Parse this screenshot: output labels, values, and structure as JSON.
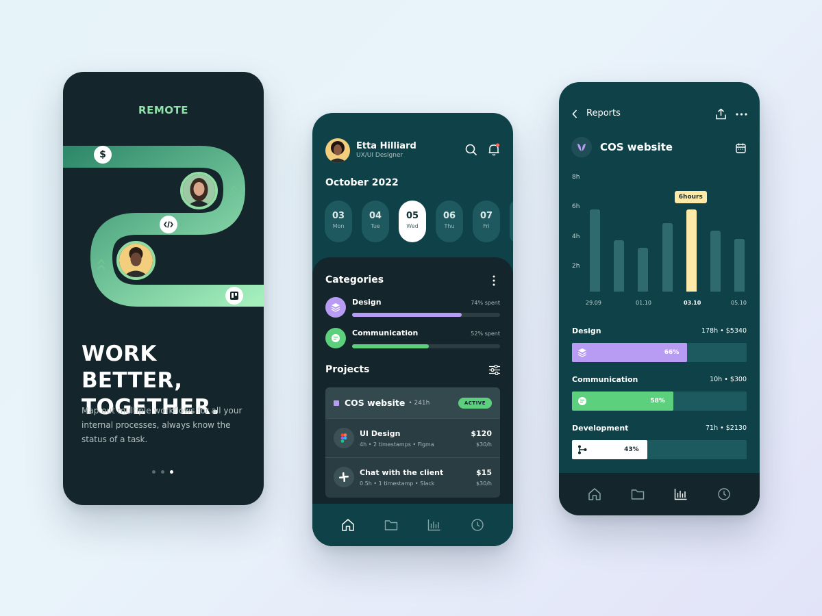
{
  "phone1": {
    "brand": "REMOTE",
    "headline": "WORK BETTER,\nTOGETHER.",
    "description": "Map out multiple workflows for all your internal processes, always know the status of a task.",
    "badge_dollar": "$",
    "pager": {
      "count": 3,
      "active": 2
    }
  },
  "phone2": {
    "user": {
      "name": "Etta Hilliard",
      "role": "UX/UI Designer"
    },
    "month": "October 2022",
    "days": [
      {
        "num": "03",
        "wd": "Mon"
      },
      {
        "num": "04",
        "wd": "Tue"
      },
      {
        "num": "05",
        "wd": "Wed"
      },
      {
        "num": "06",
        "wd": "Thu"
      },
      {
        "num": "07",
        "wd": "Fri"
      }
    ],
    "categories_title": "Categories",
    "categories": [
      {
        "name": "Design",
        "spent": "74% spent",
        "color": "#b89cf3",
        "fraction": 0.74
      },
      {
        "name": "Communication",
        "spent": "52% spent",
        "color": "#5dd07e",
        "fraction": 0.52
      }
    ],
    "projects_title": "Projects",
    "project": {
      "title": "COS website",
      "hours": "• 241h",
      "status": "ACTIVE"
    },
    "tasks": [
      {
        "title": "UI Design",
        "sub": "4h • 2 timestamps • Figma",
        "price": "$120",
        "rate": "$30/h"
      },
      {
        "title": "Chat with the client",
        "sub": "0.5h • 1 timestamp • Slack",
        "price": "$15",
        "rate": "$30/h"
      }
    ],
    "colors": {
      "accent_purple": "#b89cf3",
      "accent_green": "#5dd07e",
      "background": "#0e4248"
    }
  },
  "phone3": {
    "header": {
      "title": "Reports"
    },
    "app_title": "COS website",
    "chart_data": {
      "type": "bar",
      "title": "",
      "ylabel": "",
      "y_ticks": [
        "8h",
        "6h",
        "4h",
        "2h"
      ],
      "ylim": [
        0,
        8
      ],
      "x_tick_labels": [
        "29.09",
        "01.10",
        "03.10",
        "05.10"
      ],
      "values": [
        5.8,
        3.6,
        3.1,
        4.8,
        5.8,
        4.3,
        3.7
      ],
      "highlight_index": 4,
      "tooltip": "6hours",
      "colors": {
        "bar": "#2f6a6e",
        "highlight": "#fdeaa9"
      }
    },
    "categories": [
      {
        "name": "Design",
        "value": "178h • $5340",
        "percent": "66%",
        "fraction": 0.66,
        "color": "#b89cf3",
        "text_color": "#ffffff"
      },
      {
        "name": "Communication",
        "value": "10h • $300",
        "percent": "58%",
        "fraction": 0.58,
        "color": "#5dd07e",
        "text_color": "#ffffff"
      },
      {
        "name": "Development",
        "value": "71h • $2130",
        "percent": "43%",
        "fraction": 0.43,
        "color": "#ffffff",
        "text_color": "#14262b"
      }
    ]
  }
}
